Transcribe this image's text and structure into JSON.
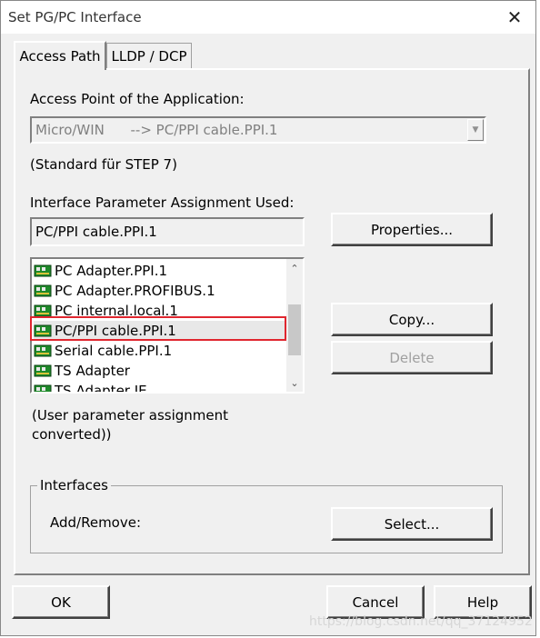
{
  "window": {
    "title": "Set PG/PC Interface"
  },
  "tabs": [
    {
      "label": "Access Path",
      "active": true
    },
    {
      "label": "LLDP / DCP",
      "active": false
    }
  ],
  "access_point": {
    "label": "Access Point of the Application:",
    "value": "Micro/WIN      --> PC/PPI cable.PPI.1",
    "note": "(Standard für STEP 7)"
  },
  "interface_param": {
    "label": "Interface Parameter Assignment Used:",
    "value": "PC/PPI cable.PPI.1",
    "properties_button": "Properties...",
    "copy_button": "Copy...",
    "delete_button": "Delete",
    "list": [
      {
        "label": "PC Adapter.PPI.1"
      },
      {
        "label": "PC Adapter.PROFIBUS.1"
      },
      {
        "label": "PC internal.local.1"
      },
      {
        "label": "PC/PPI cable.PPI.1",
        "selected": true
      },
      {
        "label": "Serial cable.PPI.1"
      },
      {
        "label": "TS Adapter"
      },
      {
        "label": "TS Adapter IE"
      }
    ],
    "note_line1": "(User parameter assignment",
    "note_line2": "converted))"
  },
  "interfaces": {
    "legend": "Interfaces",
    "label": "Add/Remove:",
    "select_button": "Select..."
  },
  "footer": {
    "ok": "OK",
    "cancel": "Cancel",
    "help": "Help"
  },
  "watermark": "https://blog.csdn.net/qq_37124952",
  "colors": {
    "highlight": "#e0262f",
    "dialog_bg": "#f0f0f0"
  }
}
